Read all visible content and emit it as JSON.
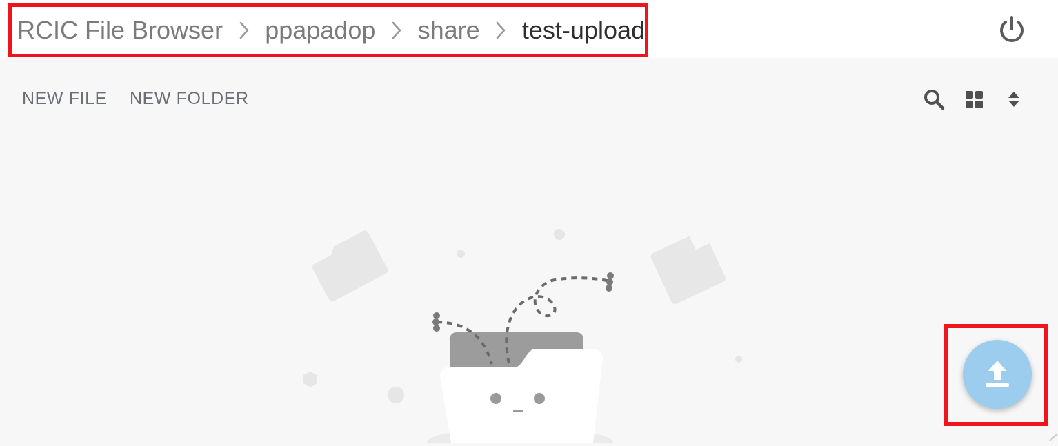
{
  "breadcrumb": {
    "items": [
      {
        "label": "RCIC File Browser"
      },
      {
        "label": "ppapadop"
      },
      {
        "label": "share"
      },
      {
        "label": "test-upload"
      }
    ]
  },
  "header": {
    "power_icon": "power-icon"
  },
  "toolbar": {
    "new_file_label": "NEW FILE",
    "new_folder_label": "NEW FOLDER",
    "icons": [
      "search-icon",
      "grid-view-icon",
      "sort-icon"
    ]
  },
  "empty_state": {
    "illustration": "empty-folder-illustration"
  },
  "upload": {
    "icon": "upload-icon",
    "color": "#9ccdee"
  },
  "colors": {
    "highlight": "#f0151c",
    "accent": "#9ccdee",
    "text": "#6d6f76"
  }
}
